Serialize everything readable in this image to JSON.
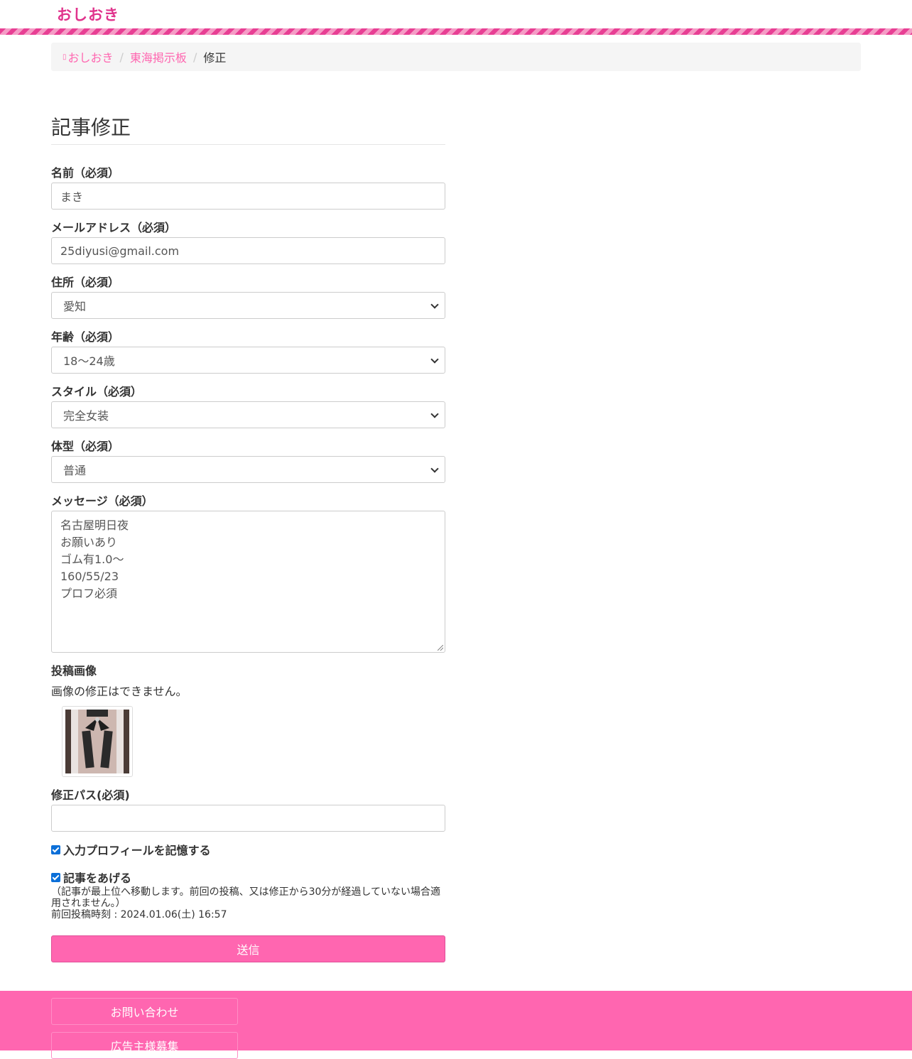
{
  "site": {
    "logo": "おしおき"
  },
  "breadcrumb": {
    "items": [
      {
        "label": "おしおき"
      },
      {
        "label": "東海掲示板"
      },
      {
        "label": "修正"
      }
    ]
  },
  "form": {
    "title": "記事修正",
    "name": {
      "label": "名前（必須）",
      "value": "まき"
    },
    "email": {
      "label": "メールアドレス（必須）",
      "value": "25diyusi@gmail.com"
    },
    "address": {
      "label": "住所（必須）",
      "selected": "愛知"
    },
    "age": {
      "label": "年齢（必須）",
      "selected": "18〜24歳"
    },
    "style": {
      "label": "スタイル（必須）",
      "selected": "完全女装"
    },
    "body_type": {
      "label": "体型（必須）",
      "selected": "普通"
    },
    "message": {
      "label": "メッセージ（必須）",
      "lines": [
        "名古屋明日夜",
        "お願いあり",
        "ゴム有1.0〜",
        "160/55/23",
        "プロフ必須"
      ]
    },
    "image": {
      "label": "投稿画像",
      "note": "画像の修正はできません。"
    },
    "edit_pass": {
      "label": "修正パス(必須)",
      "value": ""
    },
    "remember_profile": {
      "label": "入力プロフィールを記憶する",
      "checked": true
    },
    "bump_post": {
      "label": "記事をあげる",
      "checked": true,
      "note": "（記事が最上位へ移動します。前回の投稿、又は修正から30分が経過していない場合適用されません。）",
      "last_posted": "前回投稿時刻 : 2024.01.06(土) 16:57"
    },
    "submit_label": "送信"
  },
  "footer": {
    "links": [
      {
        "label": "お問い合わせ"
      },
      {
        "label": "広告主様募集"
      }
    ]
  },
  "colors": {
    "brand_pink": "#ff66b0",
    "logo_pink": "#e0338c",
    "checkbox_blue": "#0b6fd8"
  }
}
